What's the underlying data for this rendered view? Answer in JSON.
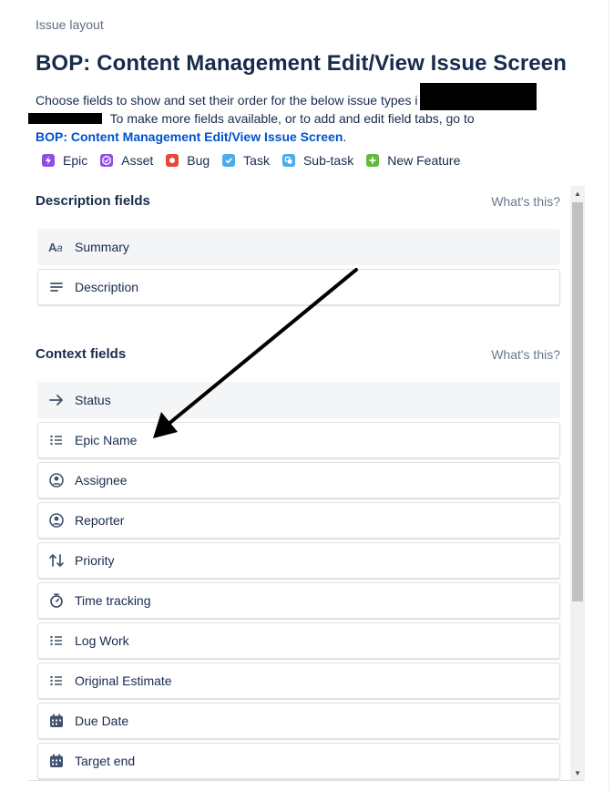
{
  "breadcrumb": "Issue layout",
  "page_title": "BOP: Content Management Edit/View Issue Screen",
  "intro": {
    "line1": "Choose fields to show and set their order for the below issue types i",
    "line3_text": " To make more fields available, or to add and edit field tabs, go to",
    "link_text": "BOP: Content Management Edit/View Issue Screen",
    "link_suffix": "."
  },
  "issue_types": [
    {
      "label": "Epic",
      "icon": "lightning-icon",
      "color": "#904ee2"
    },
    {
      "label": "Asset",
      "icon": "check-circle-icon",
      "color": "#904ee2"
    },
    {
      "label": "Bug",
      "icon": "bug-icon",
      "color": "#e5493a"
    },
    {
      "label": "Task",
      "icon": "checkbox-icon",
      "color": "#4bade8"
    },
    {
      "label": "Sub-task",
      "icon": "subtask-icon",
      "color": "#4bade8"
    },
    {
      "label": "New Feature",
      "icon": "plus-icon",
      "color": "#63ba3c"
    }
  ],
  "sections": {
    "description": {
      "title": "Description fields",
      "help": "What's this?",
      "fields": [
        {
          "label": "Summary",
          "icon": "text-icon"
        },
        {
          "label": "Description",
          "icon": "align-left-icon"
        }
      ]
    },
    "context": {
      "title": "Context fields",
      "help": "What's this?",
      "fields": [
        {
          "label": "Status",
          "icon": "arrow-right-icon"
        },
        {
          "label": "Epic Name",
          "icon": "list-icon"
        },
        {
          "label": "Assignee",
          "icon": "person-circle-icon"
        },
        {
          "label": "Reporter",
          "icon": "person-circle-icon"
        },
        {
          "label": "Priority",
          "icon": "priority-arrows-icon"
        },
        {
          "label": "Time tracking",
          "icon": "stopwatch-icon"
        },
        {
          "label": "Log Work",
          "icon": "list-icon"
        },
        {
          "label": "Original Estimate",
          "icon": "list-icon"
        },
        {
          "label": "Due Date",
          "icon": "calendar-icon"
        },
        {
          "label": "Target end",
          "icon": "calendar-icon"
        }
      ]
    }
  }
}
